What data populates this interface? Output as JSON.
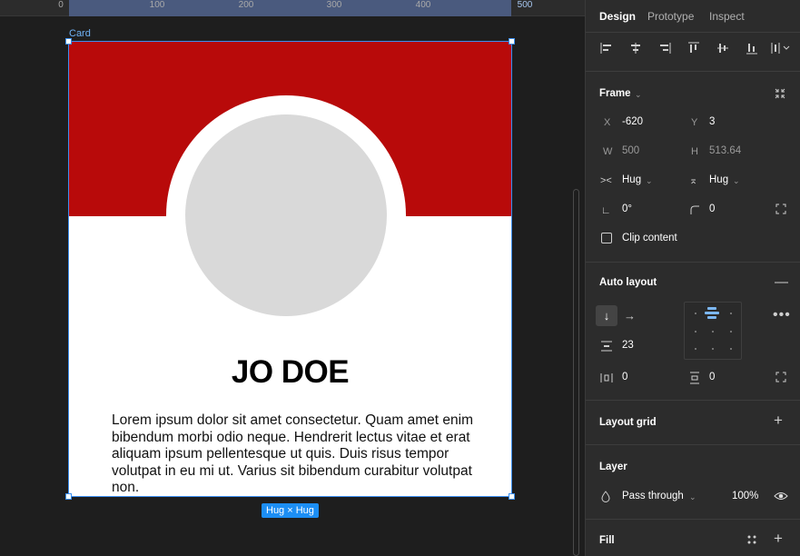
{
  "ruler": {
    "ticks": [
      "0",
      "100",
      "200",
      "300",
      "400",
      "500"
    ]
  },
  "canvas": {
    "frame_label": "Card",
    "card": {
      "name": "JO DOE",
      "bio": "Lorem ipsum dolor sit amet consectetur. Quam amet enim bibendum morbi odio neque. Hendrerit lectus vitae et erat aliquam ipsum pellentesque ut quis. Duis risus tempor volutpat in eu mi ut. Varius sit bibendum curabitur volutpat non.",
      "banner_color": "#b80a0a",
      "avatar_color": "#d9d9d9"
    },
    "size_badge": "Hug × Hug",
    "selection_color": "#3b8ef0"
  },
  "panel": {
    "tabs": [
      "Design",
      "Prototype",
      "Inspect"
    ],
    "frame": {
      "title": "Frame",
      "x_label": "X",
      "x": "-620",
      "y_label": "Y",
      "y": "3",
      "w_label": "W",
      "w": "500",
      "h_label": "H",
      "h": "513.64",
      "width_mode": "Hug",
      "height_mode": "Hug",
      "rotation": "0°",
      "radius": "0",
      "clip_content_label": "Clip content"
    },
    "auto_layout": {
      "title": "Auto layout",
      "gap": "23",
      "padding_h": "0",
      "padding_v": "0"
    },
    "layout_grid": {
      "title": "Layout grid"
    },
    "layer": {
      "title": "Layer",
      "blend_mode": "Pass through",
      "opacity": "100%"
    },
    "fill": {
      "title": "Fill"
    }
  }
}
